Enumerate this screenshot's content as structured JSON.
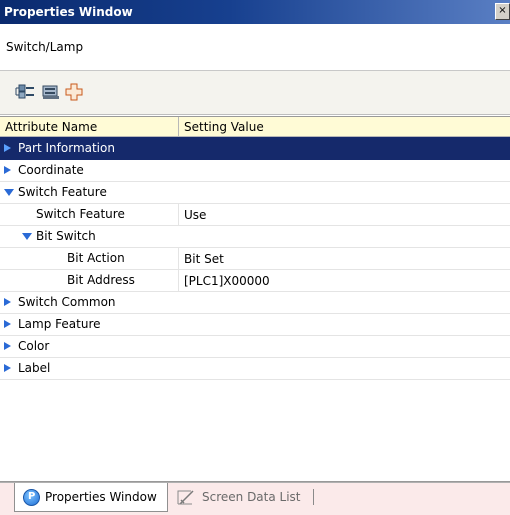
{
  "window": {
    "title": "Properties Window",
    "close_glyph": "×"
  },
  "header": {
    "selection": "Switch/Lamp"
  },
  "toolbar": {
    "buttons": [
      {
        "icon": "categorized-view-icon"
      },
      {
        "icon": "alphabetical-view-icon"
      },
      {
        "icon": "expand-all-icon"
      }
    ]
  },
  "grid": {
    "columns": [
      "Attribute Name",
      "Setting Value"
    ],
    "rows": [
      {
        "label": "Part Information",
        "value": "",
        "level": 0,
        "expander": "collapsed",
        "selected": true
      },
      {
        "label": "Coordinate",
        "value": "",
        "level": 0,
        "expander": "collapsed"
      },
      {
        "label": "Switch Feature",
        "value": "",
        "level": 0,
        "expander": "expanded"
      },
      {
        "label": "Switch Feature",
        "value": "Use",
        "level": 1,
        "expander": "none"
      },
      {
        "label": "Bit Switch",
        "value": "",
        "level": 1,
        "expander": "expanded"
      },
      {
        "label": "Bit Action",
        "value": "Bit Set",
        "level": 2,
        "expander": "none"
      },
      {
        "label": "Bit Address",
        "value": "[PLC1]X00000",
        "level": 2,
        "expander": "none"
      },
      {
        "label": "Switch Common",
        "value": "",
        "level": 0,
        "expander": "collapsed"
      },
      {
        "label": "Lamp Feature",
        "value": "",
        "level": 0,
        "expander": "collapsed"
      },
      {
        "label": "Color",
        "value": "",
        "level": 0,
        "expander": "collapsed"
      },
      {
        "label": "Label",
        "value": "",
        "level": 0,
        "expander": "collapsed"
      }
    ]
  },
  "tabs": [
    {
      "label": "Properties Window",
      "active": true,
      "icon": "properties-icon",
      "icon_glyph": "P"
    },
    {
      "label": "Screen Data List",
      "active": false,
      "icon": "screen-data-list-icon"
    }
  ]
}
